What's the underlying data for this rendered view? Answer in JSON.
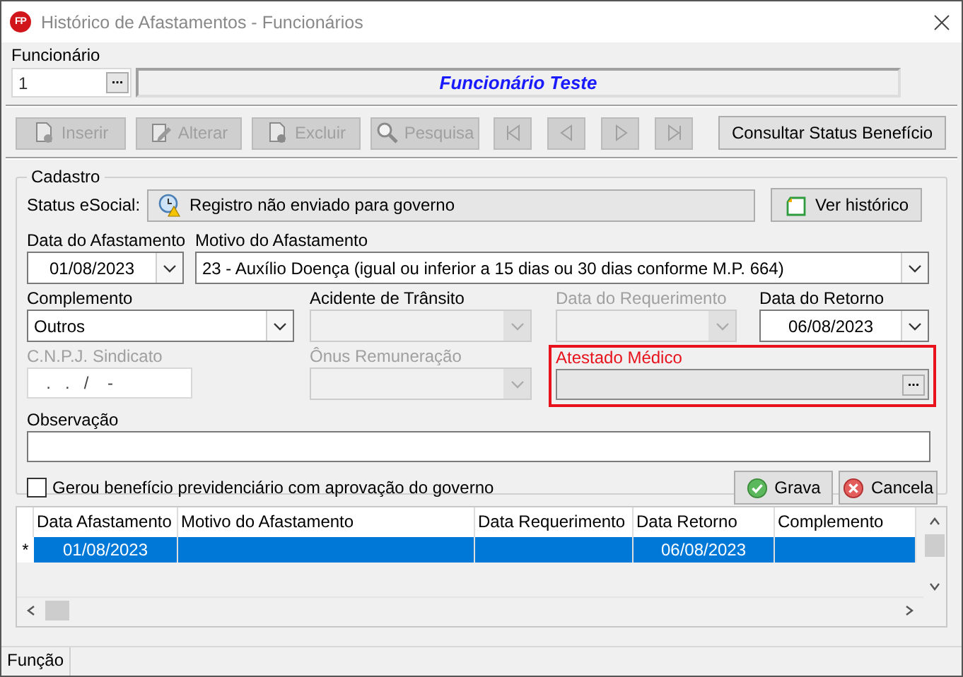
{
  "window": {
    "icon_text": "FP",
    "title": "Histórico de Afastamentos - Funcionários"
  },
  "employee": {
    "label": "Funcionário",
    "code": "1",
    "lookup_button": "...",
    "name": "Funcionário Teste"
  },
  "toolbar": {
    "buttons": [
      {
        "kind": "insert",
        "label": "Inserir",
        "disabled": true
      },
      {
        "kind": "edit",
        "label": "Alterar",
        "disabled": true
      },
      {
        "kind": "delete",
        "label": "Excluir",
        "disabled": true
      },
      {
        "kind": "search",
        "label": "Pesquisa",
        "disabled": true
      }
    ],
    "nav": [
      {
        "kind": "first",
        "disabled": true
      },
      {
        "kind": "prev",
        "disabled": true
      },
      {
        "kind": "next",
        "disabled": true
      },
      {
        "kind": "last",
        "disabled": true
      }
    ],
    "status_button": "Consultar Status Benefício"
  },
  "cadastro": {
    "title": "Cadastro",
    "status_label": "Status eSocial:",
    "status_text": "Registro não enviado para governo",
    "history_button": "Ver histórico",
    "field_rows": [
      [
        {
          "kind": "combo",
          "label": "Data do Afastamento",
          "value": "01/08/2023",
          "centered": true,
          "disabled": false,
          "label_disabled": false,
          "highlighted": false
        },
        {
          "kind": "combo",
          "label": "Motivo do Afastamento",
          "value": "23  -  Auxílio Doença (igual ou inferior a 15 dias ou 30 dias conforme M.P. 664)",
          "centered": false,
          "disabled": false,
          "label_disabled": false,
          "highlighted": false
        }
      ],
      [
        {
          "kind": "combo",
          "label": "Complemento",
          "value": "Outros",
          "centered": false,
          "disabled": false,
          "label_disabled": false,
          "highlighted": false
        },
        {
          "kind": "combo",
          "label": "Acidente de Trânsito",
          "disabled": true,
          "label_disabled": false
        },
        {
          "kind": "combo",
          "label": "Data do Requerimento",
          "disabled": true,
          "label_disabled": true
        },
        {
          "kind": "combo",
          "label": "Data do Retorno",
          "value": "06/08/2023",
          "centered": true,
          "disabled": false,
          "label_disabled": false,
          "highlighted": false
        }
      ],
      [
        {
          "kind": "masked",
          "label": "C.N.P.J. Sindicato",
          "value": "  .   .   /    -",
          "disabled": false,
          "label_disabled": true
        },
        {
          "kind": "combo",
          "label": "Ônus Remuneração",
          "disabled": true,
          "label_disabled": true
        },
        {
          "kind": "lookup",
          "label": "Atestado Médico",
          "button": "...",
          "disabled": true,
          "label_disabled": false,
          "highlighted": true
        }
      ]
    ],
    "observation": {
      "label": "Observação"
    },
    "checkbox": {
      "label": "Gerou benefício previdenciário com aprovação do governo",
      "checked": false
    },
    "buttons": [
      {
        "kind": "save",
        "label": "Grava"
      },
      {
        "kind": "cancel",
        "label": "Cancela"
      }
    ]
  },
  "grid": {
    "columns": [
      "Data Afastamento",
      "Motivo do Afastamento",
      "Data Requerimento",
      "Data Retorno",
      "Complemento"
    ],
    "rows": [
      {
        "marker": "*",
        "selected": true,
        "cells": [
          "01/08/2023",
          "",
          "",
          "06/08/2023",
          ""
        ]
      }
    ]
  },
  "status_bar": {
    "text": "Função"
  }
}
